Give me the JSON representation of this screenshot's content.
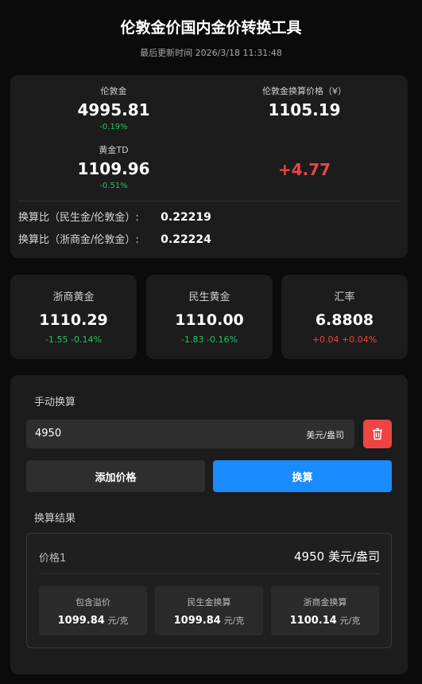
{
  "header": {
    "title": "伦敦金价国内金价转换工具",
    "updated": "最后更新时间 2026/3/18 11:31:48"
  },
  "summary": {
    "london_gold": {
      "label": "伦敦金",
      "value": "4995.81",
      "change": "-0.19%"
    },
    "london_cny": {
      "label": "伦敦金换算价格（¥）",
      "value": "1105.19"
    },
    "gold_td": {
      "label": "黄金TD",
      "value": "1109.96",
      "change": "-0.51%"
    },
    "difference": {
      "value": "+4.77"
    },
    "ratios": [
      {
        "label": "换算比（民生金/伦敦金）:",
        "value": "0.22219"
      },
      {
        "label": "换算比（浙商金/伦敦金）:",
        "value": "0.22224"
      }
    ]
  },
  "tiles": [
    {
      "label": "浙商黄金",
      "value": "1110.29",
      "change": "-1.55 -0.14%"
    },
    {
      "label": "民生黄金",
      "value": "1110.00",
      "change": "-1.83 -0.16%"
    },
    {
      "label": "汇率",
      "value": "6.8808",
      "change": "+0.04 +0.04%"
    }
  ],
  "manual": {
    "section_label": "手动换算",
    "input_value": "4950",
    "input_unit": "美元/盎司",
    "delete_icon": "trash-icon",
    "add_label": "添加价格",
    "convert_label": "换算",
    "result_label": "换算结果",
    "result": {
      "name": "价格1",
      "value": "4950 美元/盎司",
      "items": [
        {
          "label": "包含溢价",
          "value": "1099.84",
          "unit": "元/克"
        },
        {
          "label": "民生金换算",
          "value": "1099.84",
          "unit": "元/克"
        },
        {
          "label": "浙商金换算",
          "value": "1100.14",
          "unit": "元/克"
        }
      ]
    }
  },
  "colors": {
    "up": "#ef4444",
    "down": "#22c55e",
    "accent": "#1a8cff"
  }
}
